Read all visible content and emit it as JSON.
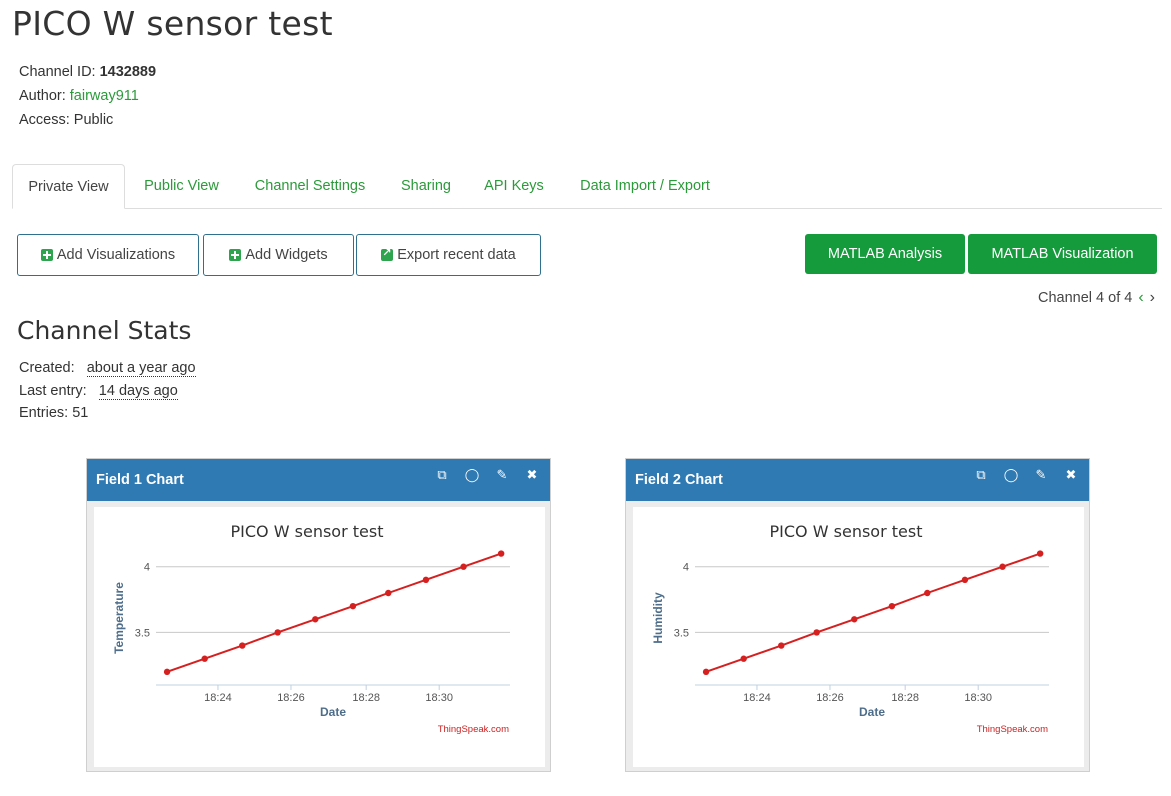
{
  "page": {
    "title": "PICO W sensor test"
  },
  "meta": {
    "channel_id_label": "Channel ID:",
    "channel_id": "1432889",
    "author_label": "Author:",
    "author": "fairway911",
    "access_label": "Access:",
    "access": "Public"
  },
  "tabs": [
    "Private View",
    "Public View",
    "Channel Settings",
    "Sharing",
    "API Keys",
    "Data Import / Export"
  ],
  "buttons": {
    "add_visualizations": "Add Visualizations",
    "add_widgets": "Add Widgets",
    "export_recent": "Export recent data",
    "matlab_analysis": "MATLAB Analysis",
    "matlab_visualization": "MATLAB Visualization"
  },
  "pager": {
    "text": "Channel 4 of 4"
  },
  "stats": {
    "title": "Channel Stats",
    "created_label": "Created:",
    "created": "about a year ago",
    "last_entry_label": "Last entry:",
    "last_entry": "14 days ago",
    "entries_label": "Entries:",
    "entries": "51"
  },
  "widgets": [
    {
      "header": "Field 1 Chart"
    },
    {
      "header": "Field 2 Chart"
    }
  ],
  "colors": {
    "brand_green": "#159a3c",
    "header_blue": "#2f7ab3",
    "series_red": "#d62020",
    "link_green": "#2b9a3a"
  },
  "chart_data": [
    {
      "type": "line",
      "title": "PICO W sensor test",
      "xlabel": "Date",
      "ylabel": "Temperature",
      "credit": "ThingSpeak.com",
      "x_ticks": [
        "18:24",
        "18:26",
        "18:28",
        "18:30"
      ],
      "x_tick_positions": [
        18.4,
        18.433,
        18.467,
        18.5
      ],
      "y_ticks": [
        3.5,
        4
      ],
      "xlim": [
        18.372,
        18.532
      ],
      "ylim": [
        3.1,
        4.15
      ],
      "x": [
        18.377,
        18.394,
        18.411,
        18.427,
        18.444,
        18.461,
        18.477,
        18.494,
        18.511,
        18.528
      ],
      "values": [
        3.2,
        3.3,
        3.4,
        3.5,
        3.6,
        3.7,
        3.8,
        3.9,
        4.0,
        4.1
      ]
    },
    {
      "type": "line",
      "title": "PICO W sensor test",
      "xlabel": "Date",
      "ylabel": "Humidity",
      "credit": "ThingSpeak.com",
      "x_ticks": [
        "18:24",
        "18:26",
        "18:28",
        "18:30"
      ],
      "x_tick_positions": [
        18.4,
        18.433,
        18.467,
        18.5
      ],
      "y_ticks": [
        3.5,
        4
      ],
      "xlim": [
        18.372,
        18.532
      ],
      "ylim": [
        3.1,
        4.15
      ],
      "x": [
        18.377,
        18.394,
        18.411,
        18.427,
        18.444,
        18.461,
        18.477,
        18.494,
        18.511,
        18.528
      ],
      "values": [
        3.2,
        3.3,
        3.4,
        3.5,
        3.6,
        3.7,
        3.8,
        3.9,
        4.0,
        4.1
      ]
    }
  ]
}
